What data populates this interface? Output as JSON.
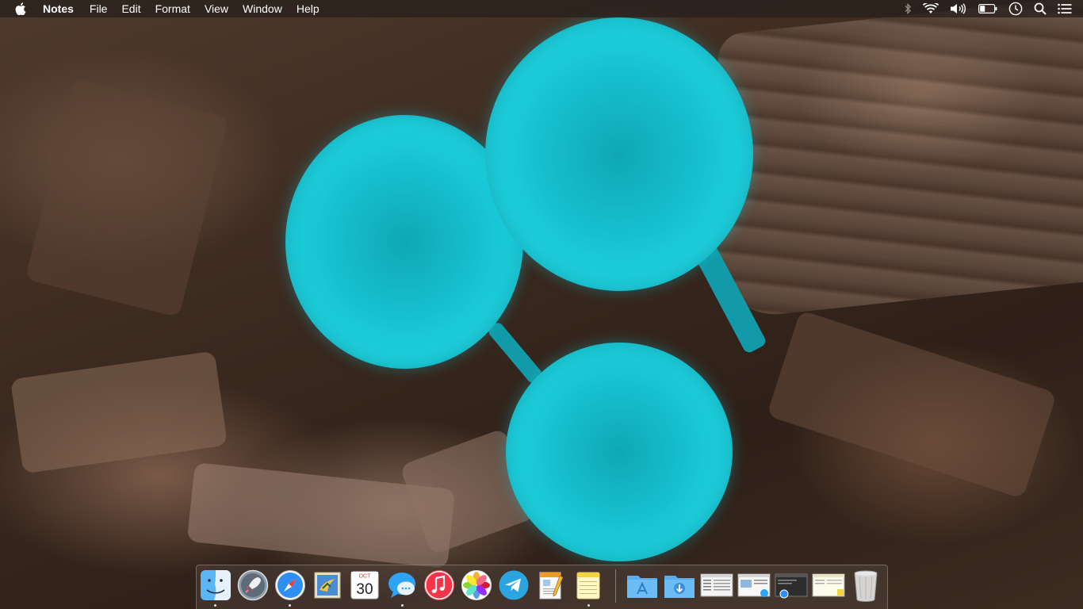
{
  "menubar": {
    "app_name": "Notes",
    "menus": [
      "File",
      "Edit",
      "Format",
      "View",
      "Window",
      "Help"
    ],
    "status_icons": [
      "bluetooth-icon",
      "wifi-icon",
      "volume-icon",
      "battery-icon",
      "clock-icon",
      "spotlight-search-icon",
      "notification-center-icon"
    ]
  },
  "dock": {
    "apps": [
      {
        "name": "Finder",
        "icon": "finder-icon",
        "running": true
      },
      {
        "name": "Launchpad",
        "icon": "launchpad-icon",
        "running": false
      },
      {
        "name": "Safari",
        "icon": "safari-icon",
        "running": true
      },
      {
        "name": "Mail",
        "icon": "mail-icon",
        "running": false
      },
      {
        "name": "Calendar",
        "icon": "calendar-icon",
        "running": false,
        "month": "OCT",
        "day": "30"
      },
      {
        "name": "Messages",
        "icon": "messages-icon",
        "running": true
      },
      {
        "name": "iTunes",
        "icon": "itunes-icon",
        "running": false
      },
      {
        "name": "Photos",
        "icon": "photos-icon",
        "running": false
      },
      {
        "name": "Telegram",
        "icon": "telegram-icon",
        "running": false
      },
      {
        "name": "Pages",
        "icon": "pages-icon",
        "running": false
      },
      {
        "name": "Notes",
        "icon": "notes-icon",
        "running": true
      }
    ],
    "stacks": [
      {
        "name": "Applications",
        "icon": "applications-folder-icon"
      },
      {
        "name": "Downloads",
        "icon": "downloads-folder-icon"
      },
      {
        "name": "Window 1",
        "icon": "window-thumbnail-icon"
      },
      {
        "name": "Window 2",
        "icon": "window-thumbnail-icon"
      },
      {
        "name": "Window 3",
        "icon": "window-thumbnail-icon"
      },
      {
        "name": "Window 4",
        "icon": "window-thumbnail-icon"
      },
      {
        "name": "Trash",
        "icon": "trash-icon"
      }
    ]
  },
  "colors": {
    "menubar_bg": "#2a201c",
    "wallpaper_accent": "#17c1d0",
    "wallpaper_bark": "#6b4a36"
  }
}
